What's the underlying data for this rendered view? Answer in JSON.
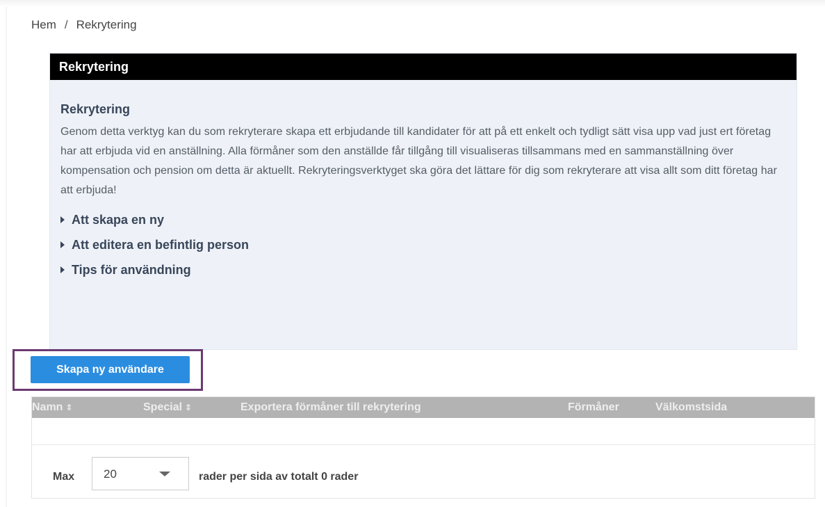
{
  "breadcrumb": {
    "items": [
      "Hem",
      "Rekrytering"
    ],
    "separator": "/"
  },
  "info": {
    "header": "Rekrytering",
    "title": "Rekrytering",
    "text": "Genom detta verktyg kan du som rekryterare skapa ett erbjudande till kandidater för att på ett enkelt och tydligt sätt visa upp vad just ert företag har att erbjuda vid en anställning. Alla förmåner som den anställde får tillgång till visualiseras tillsammans med en sammanställning över kompensation och pension om detta är aktuellt. Rekryteringsverktyget ska göra det lättare för dig som rekryterare att visa allt som ditt företag har att erbjuda!",
    "accordion": [
      "Att skapa en ny",
      "Att editera en befintlig person",
      "Tips för användning"
    ]
  },
  "create_button": "Skapa ny användare",
  "table": {
    "columns": [
      {
        "label": "Namn",
        "sortable": true
      },
      {
        "label": "Special",
        "sortable": true
      },
      {
        "label": "Exportera förmåner till rekrytering",
        "sortable": false
      },
      {
        "label": "Förmåner",
        "sortable": false
      },
      {
        "label": "Välkomstsida",
        "sortable": false
      }
    ],
    "sort_icon": "⇕",
    "rows": []
  },
  "pager": {
    "label": "Max",
    "page_size": "20",
    "text": "rader per sida av totalt 0 rader"
  },
  "colors": {
    "header_bg": "#000000",
    "info_bg": "#eef2f8",
    "button_bg": "#2b8de0",
    "highlight_frame": "#6b3a72",
    "table_head_bg": "#b3b3b3"
  }
}
